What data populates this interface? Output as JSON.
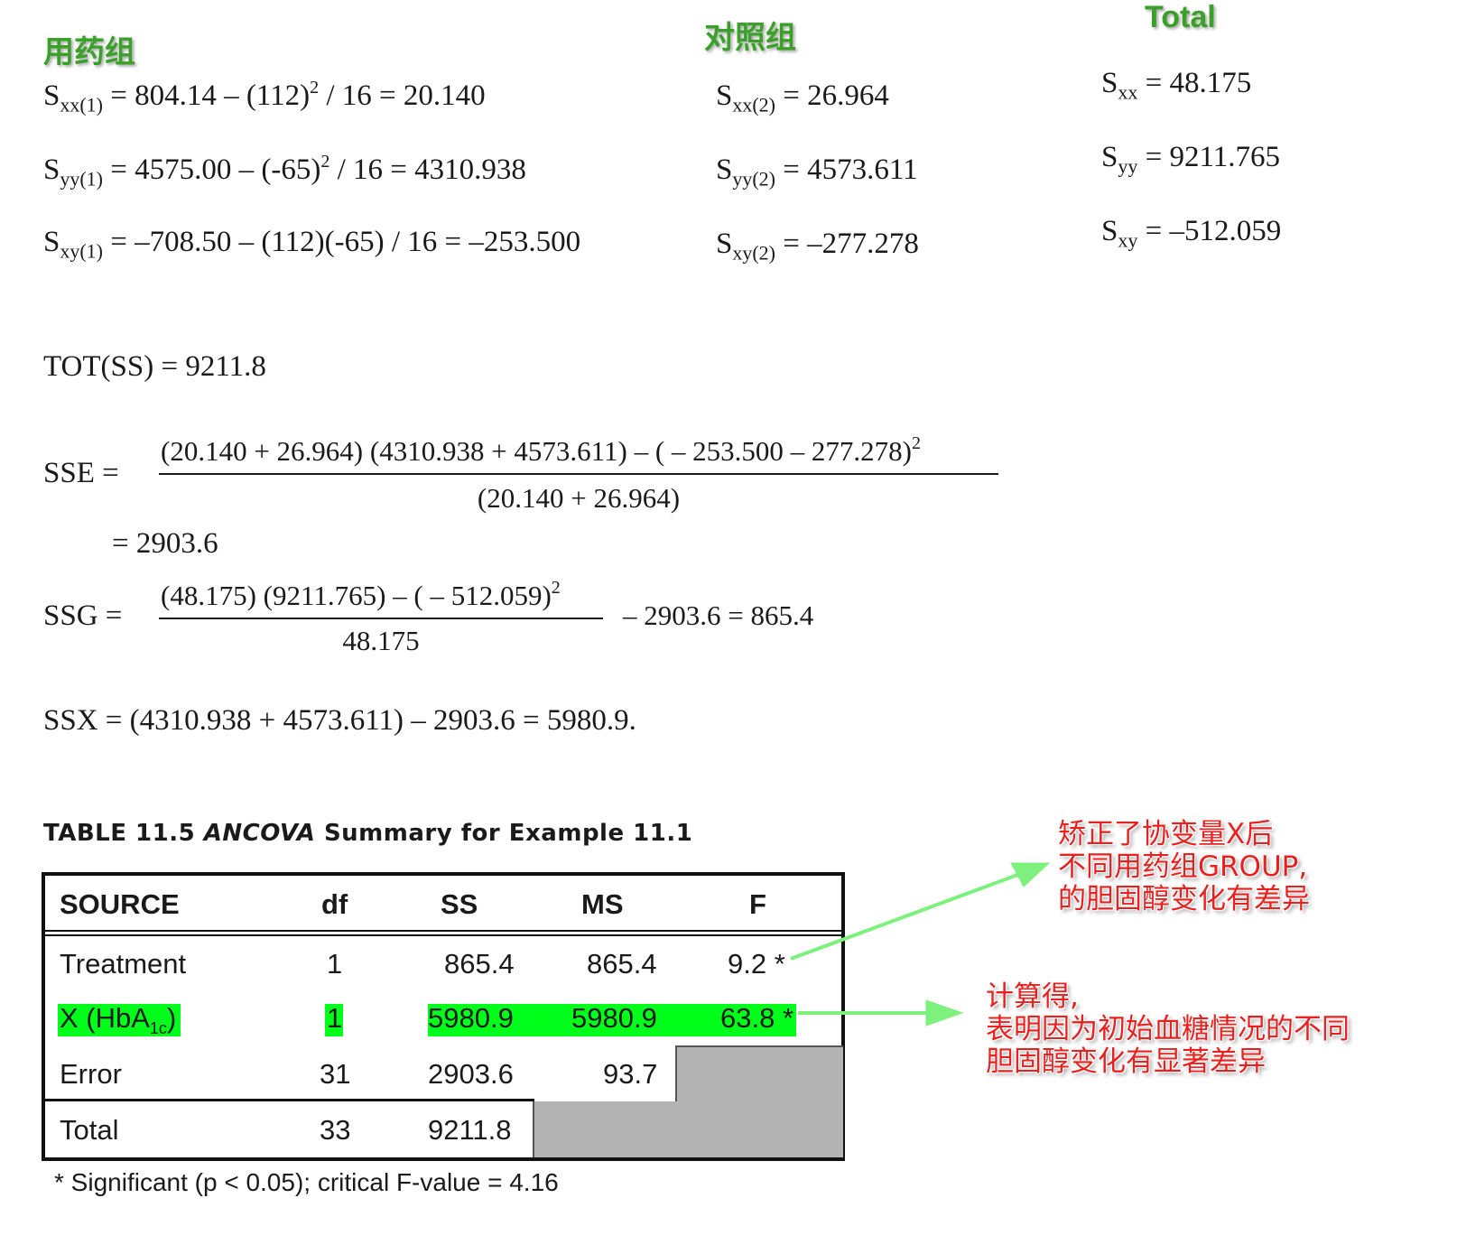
{
  "groups": {
    "drug_label": "用药组",
    "control_label": "对照组",
    "total_label": "Total"
  },
  "drug": {
    "sxx": {
      "sub": "xx(1)",
      "expr_a": "= 804.14 – (112)",
      "exp": "2",
      "expr_b": "/ 16 = 20.140"
    },
    "syy": {
      "sub": "yy(1)",
      "expr_a": "= 4575.00 – (-65)",
      "exp": "2",
      "expr_b": "/ 16 = 4310.938"
    },
    "sxy": {
      "sub": "xy(1)",
      "expr": "= –708.50 – (112)(-65) / 16 = –253.500"
    }
  },
  "control": {
    "sxx": {
      "sub": "xx(2)",
      "expr": "= 26.964"
    },
    "syy": {
      "sub": "yy(2)",
      "expr": "= 4573.611"
    },
    "sxy": {
      "sub": "xy(2)",
      "expr": "= –277.278"
    }
  },
  "total": {
    "sxx": {
      "sub": "xx",
      "expr": "= 48.175"
    },
    "syy": {
      "sub": "yy",
      "expr": "= 9211.765"
    },
    "sxy": {
      "sub": "xy",
      "expr": "= –512.059"
    }
  },
  "tot": "TOT(SS) = 9211.8",
  "sse": {
    "lhs": "SSE =",
    "numerator": "(20.140 + 26.964) (4310.938 + 4573.611) – ( – 253.500 – 277.278)",
    "num_exp": "2",
    "denominator": "(20.140 + 26.964)",
    "result": "= 2903.6"
  },
  "ssg": {
    "lhs": "SSG =",
    "numerator": "(48.175) (9211.765) – ( – 512.059)",
    "num_exp": "2",
    "denominator": "48.175",
    "tail": "– 2903.6 = 865.4"
  },
  "ssx": "SSX = (4310.938 + 4573.611) – 2903.6 = 5980.9.",
  "table": {
    "title_prefix": "TABLE 11.5",
    "title_italic": "ANCOVA",
    "title_suffix": "Summary for Example 11.1",
    "headers": [
      "SOURCE",
      "df",
      "SS",
      "MS",
      "F"
    ],
    "rows": [
      {
        "source": "Treatment",
        "df": "1",
        "ss": "865.4",
        "ms": "865.4",
        "f": "9.2 *"
      },
      {
        "source_main": "X (HbA",
        "source_sub": "1c",
        "source_end": ")",
        "df": "1",
        "ss": "5980.9",
        "ms": "5980.9",
        "f": "63.8 *"
      },
      {
        "source": "Error",
        "df": "31",
        "ss": "2903.6",
        "ms": "93.7",
        "f": ""
      },
      {
        "source": "Total",
        "df": "33",
        "ss": "9211.8",
        "ms": "",
        "f": ""
      }
    ],
    "footnote": "* Significant (p < 0.05); critical F-value = 4.16",
    "highlight_color": "#00ff1a"
  },
  "annotations": {
    "upper": [
      "矫正了协变量X后",
      "不同用药组GROUP,",
      "的胆固醇变化有差异"
    ],
    "lower": [
      "计算得,",
      "表明因为初始血糖情况的不同",
      "胆固醇变化有显著差异"
    ],
    "text_color": "#e8201e",
    "arrow_color": "#7ef07e"
  }
}
